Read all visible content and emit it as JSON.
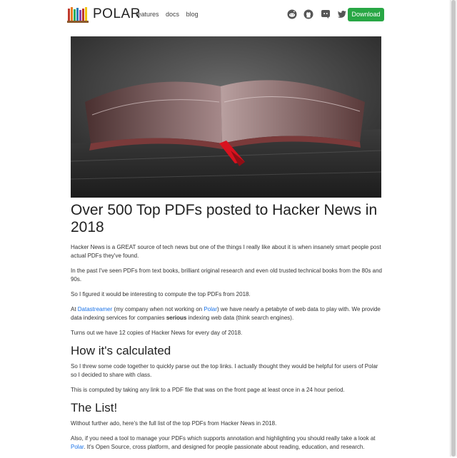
{
  "header": {
    "brand": "POLAR",
    "nav": [
      "features",
      "docs",
      "blog"
    ],
    "social_icons": [
      "reddit-icon",
      "github-icon",
      "discord-icon",
      "twitter-icon"
    ],
    "download_label": "Download",
    "accent_color": "#28a745"
  },
  "article": {
    "title": "Over 500 Top PDFs posted to Hacker News in 2018",
    "p1": "Hacker News is a GREAT source of tech news but one of the things I really like about it is when insanely smart people post actual PDFs they've found.",
    "p2": "In the past I've seen PDFs from text books, brilliant original research and even old trusted technical books from the 80s and 90s.",
    "p3": "So I figured it would be interesting to compute the top PDFs from 2018.",
    "p4": {
      "t1": "At ",
      "link1": "Datastreamer",
      "t2": " (my company when not working on ",
      "link2": "Polar",
      "t3": ") we have nearly a petabyte of web data to play with. We provide data indexing services for companies ",
      "bold": "serious",
      "t4": " indexing web data (think search engines)."
    },
    "p5": "Turns out we have 12 copies of Hacker News for every day of 2018.",
    "h2_calc": "How it's calculated",
    "p6": "So I threw some code together to quickly parse out the top links. I actually thought they would be helpful for users of Polar so I decided to share with class.",
    "p7": "This is computed by taking any link to a PDF file that was on the front page at least once in a 24 hour period.",
    "h2_list": "The List!",
    "p8": "Without further ado, here's the full list of the top PDFs from Hacker News in 2018.",
    "p9": {
      "t1": "Also, if you need a tool to manage your PDFs which supports annotation and highlighting you should really take a look at ",
      "link": "Polar",
      "t2": ". It's Open Source, cross platform, and designed for people passionate about reading, education, and research."
    }
  }
}
